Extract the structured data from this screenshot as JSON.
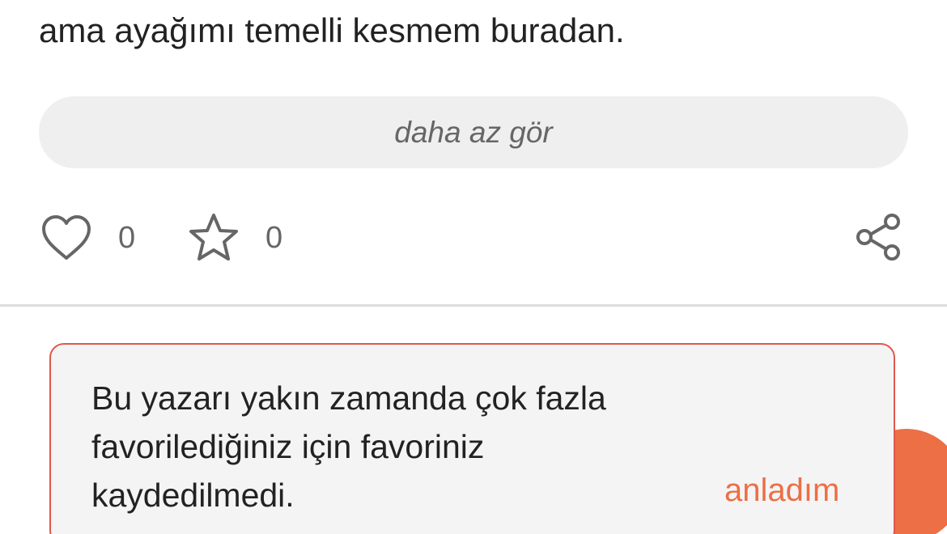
{
  "entry": {
    "text_tail": "ama ayağımı temelli kesmem buradan."
  },
  "toggle": {
    "label": "daha az gör"
  },
  "actions": {
    "like_icon": "heart-icon",
    "like_count": "0",
    "favorite_icon": "star-icon",
    "favorite_count": "0",
    "share_icon": "share-icon"
  },
  "toast": {
    "message": "Bu yazarı yakın zamanda çok fazla favorilediğiniz için favoriniz kaydedilmedi.",
    "dismiss_label": "anladım",
    "accent_color": "#ec6f45",
    "border_color": "#e0574c"
  }
}
